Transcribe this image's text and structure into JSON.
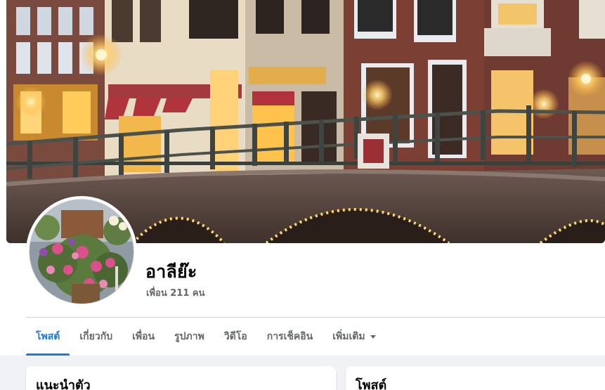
{
  "profile": {
    "name": "อาลีย๊ะ",
    "friends": "เพื่อน 211 คน"
  },
  "tabs": [
    {
      "label": "โพสต์"
    },
    {
      "label": "เกี่ยวกับ"
    },
    {
      "label": "เพื่อน"
    },
    {
      "label": "รูปภาพ"
    },
    {
      "label": "วิดีโอ"
    },
    {
      "label": "การเช็คอิน"
    },
    {
      "label": "เพิ่มเติม"
    }
  ],
  "cards": {
    "intro_title": "แนะนำตัว",
    "posts_title": "โพสต์"
  },
  "colors": {
    "accent": "#1877f2",
    "secondary_text": "#65676b",
    "feed_background": "#f0f2f5"
  },
  "icons": {
    "more_caret": "caret-down-icon"
  }
}
